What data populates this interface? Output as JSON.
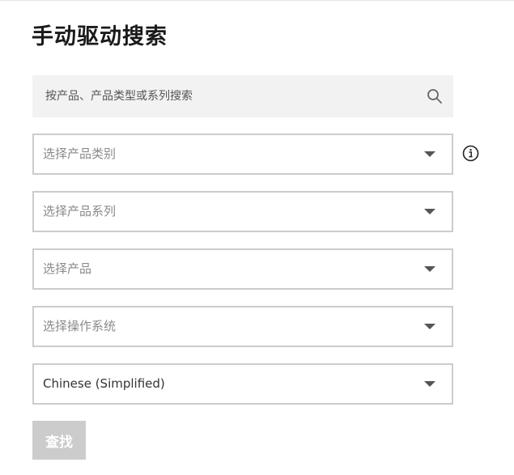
{
  "page": {
    "title": "手动驱动搜索"
  },
  "search": {
    "placeholder": "按产品、产品类型或系列搜索",
    "icon": "search-icon"
  },
  "selects": {
    "product_type": {
      "placeholder": "选择产品类别",
      "icon": "chevron-down-icon"
    },
    "product_series": {
      "placeholder": "选择产品系列",
      "icon": "chevron-down-icon"
    },
    "product": {
      "placeholder": "选择产品",
      "icon": "chevron-down-icon"
    },
    "operating_system": {
      "placeholder": "选择操作系统",
      "icon": "chevron-down-icon"
    },
    "language": {
      "value": "Chinese (Simplified)",
      "icon": "chevron-down-icon"
    }
  },
  "info": {
    "icon": "info-icon"
  },
  "actions": {
    "find_label": "查找",
    "find_disabled": true
  },
  "colors": {
    "search_bg": "#f2f2f2",
    "border": "#cccccc",
    "placeholder_text": "#8a8a8a",
    "button_disabled_bg": "#cccccc",
    "button_text": "#ffffff",
    "title_text": "#1a1a1a"
  }
}
